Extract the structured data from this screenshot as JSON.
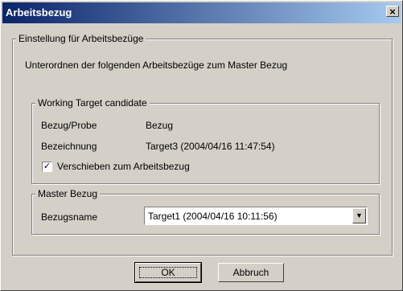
{
  "window": {
    "title": "Arbeitsbezug",
    "close_glyph": "×"
  },
  "settings_group": {
    "legend": "Einstellung für Arbeitsbezüge",
    "description": "Unterordnen der folgenden Arbeitsbezüge zum Master Bezug"
  },
  "candidate_group": {
    "legend": "Working Target candidate",
    "reference_label": "Bezug/Probe",
    "reference_value": "Bezug",
    "name_label": "Bezeichnung",
    "name_value": "Target3 (2004/04/16 11:47:54)",
    "move_checkbox_label": "Verschieben zum Arbeitsbezug",
    "move_checked": true,
    "check_glyph": "✓"
  },
  "master_group": {
    "legend": "Master Bezug",
    "name_label": "Bezugsname",
    "selected_value": "Target1 (2004/04/16 10:11:56)",
    "arrow_glyph": "▼"
  },
  "buttons": {
    "ok_label": "OK",
    "cancel_label": "Abbruch"
  }
}
